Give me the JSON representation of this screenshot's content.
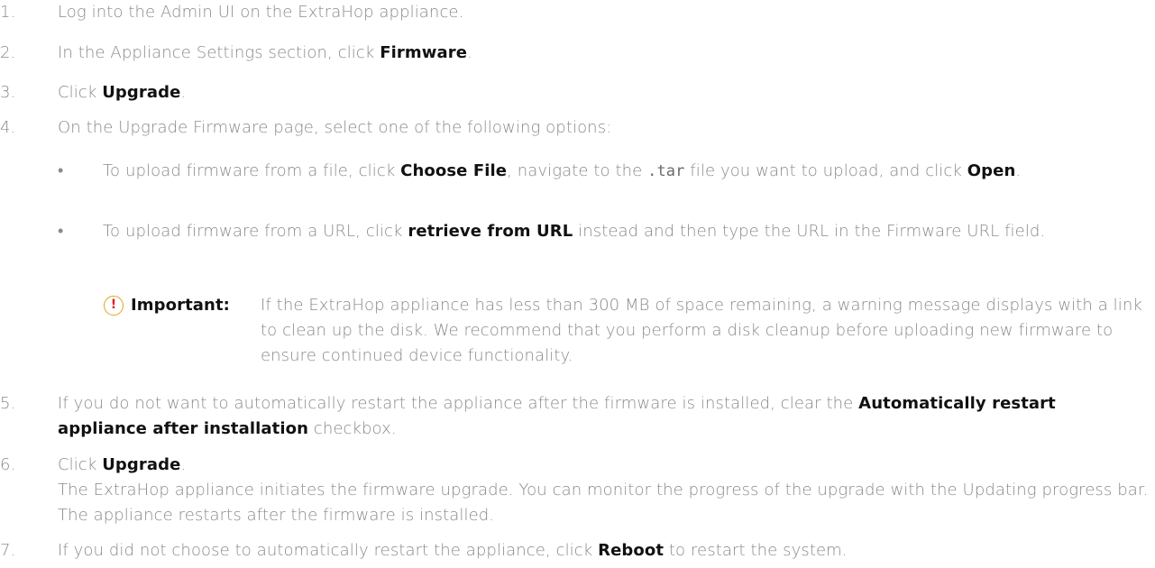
{
  "steps": [
    {
      "num": "1.",
      "parts": [
        {
          "t": "Log into the Admin UI on the ExtraHop appliance."
        }
      ]
    },
    {
      "num": "2.",
      "parts": [
        {
          "t": "In the Appliance Settings section, click "
        },
        {
          "b": "Firmware"
        },
        {
          "t": "."
        }
      ]
    },
    {
      "num": "3.",
      "parts": [
        {
          "t": "Click "
        },
        {
          "b": "Upgrade"
        },
        {
          "t": "."
        }
      ]
    },
    {
      "num": "4.",
      "parts": [
        {
          "t": "On the Upgrade Firmware page, select one of the following options:"
        }
      ]
    },
    {
      "num": "5.",
      "parts": [
        {
          "t": "If you do not want to automatically restart the appliance after the firmware is installed, clear the "
        },
        {
          "b": "Automatically restart appliance after installation"
        },
        {
          "t": " checkbox."
        }
      ]
    },
    {
      "num": "6.",
      "parts": [
        {
          "t": "Click "
        },
        {
          "b": "Upgrade"
        },
        {
          "t": "."
        }
      ]
    },
    {
      "num": "7.",
      "parts": [
        {
          "t": "If you did not choose to automatically restart the appliance, click "
        },
        {
          "b": "Reboot"
        },
        {
          "t": " to restart the system."
        }
      ]
    }
  ],
  "step6_result": "The ExtraHop appliance initiates the firmware upgrade. You can monitor the progress of the upgrade with the Updating progress bar. The appliance restarts after the firmware is installed.",
  "options": [
    {
      "parts": [
        {
          "t": "To upload firmware from a file, click "
        },
        {
          "b": "Choose File"
        },
        {
          "t": ", navigate to the "
        },
        {
          "c": ".tar"
        },
        {
          "t": " file you want to upload, and click "
        },
        {
          "b": "Open"
        },
        {
          "t": "."
        }
      ]
    },
    {
      "parts": [
        {
          "t": "To upload firmware from a URL, click "
        },
        {
          "b": "retrieve from URL"
        },
        {
          "t": " instead and then type the URL in the Firmware URL field."
        }
      ]
    }
  ],
  "note": {
    "icon": "!",
    "icon_name": "important-icon",
    "label": "Important:",
    "text": "If the ExtraHop appliance has less than 300 MB of space remaining, a warning message displays with a link to clean up the disk. We recommend that you perform a disk cleanup before uploading new firmware to ensure continued device functionality."
  },
  "colors": {
    "text": "#8a8a8a",
    "bold": "#111111",
    "icon_border": "#e5a21a",
    "icon_mark": "#d9252a"
  }
}
